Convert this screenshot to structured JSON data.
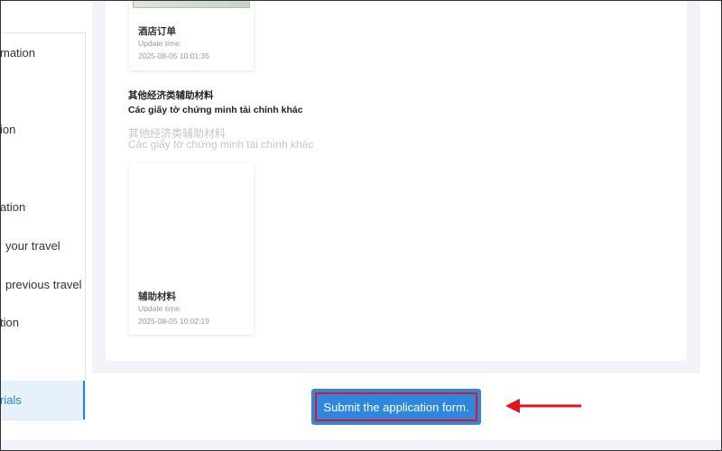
{
  "sidebar": {
    "items": [
      {
        "label": "mation"
      },
      {
        "label": "ion"
      },
      {
        "label": "ation"
      },
      {
        "label": "your travel"
      },
      {
        "label": "previous travel"
      },
      {
        "label": "tion"
      },
      {
        "label": "rials"
      }
    ]
  },
  "documents": {
    "hotel": {
      "name": "酒店订单",
      "update_label": "Update time:",
      "time": "2025-08-05 10:01:35"
    },
    "supplementary": {
      "name": "辅助材料",
      "update_label": "Update time:",
      "time": "2025-08-05 10:02:19"
    }
  },
  "section": {
    "title_cn": "其他经济类辅助材料",
    "title_vi": "Các giấy tờ chứng minh tài chính khác",
    "ghost_cn": "其他经济类辅助材料",
    "ghost_vi": "Các giấy tờ chứng minh tài chính khác"
  },
  "actions": {
    "submit_label": "Submit the application form."
  },
  "colors": {
    "accent": "#2e86de",
    "highlight": "#e0161f",
    "sidebar_active": "#1e88e5"
  }
}
